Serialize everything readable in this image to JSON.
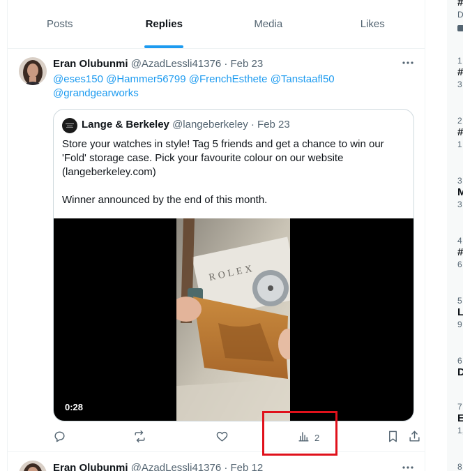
{
  "tabs": [
    {
      "label": "Posts",
      "active": false
    },
    {
      "label": "Replies",
      "active": true
    },
    {
      "label": "Media",
      "active": false
    },
    {
      "label": "Likes",
      "active": false
    }
  ],
  "post": {
    "author_name": "Eran Olubunmi",
    "handle": "@AzadLessli41376",
    "separator": "·",
    "date": "Feb 23",
    "mentions": [
      "@eses150",
      "@Hammer56799",
      "@FrenchEsthete",
      "@Tanstaafl50",
      "@grandgearworks"
    ],
    "quoted": {
      "author_name": "Lange & Berkeley",
      "handle": "@langeberkeley",
      "separator": "·",
      "date": "Feb 23",
      "text": "Store your watches in style! Tag 5 friends and get a chance to win our 'Fold' storage case. Pick your favourite colour on our website (langeberkeley.com)\n\nWinner announced by the end of this month.",
      "video_duration": "0:28",
      "video_watermark": "ROLEX"
    },
    "actions": {
      "reply_icon": "reply-icon",
      "repost_icon": "repost-icon",
      "like_icon": "like-icon",
      "views_icon": "views-icon",
      "views_count": "2",
      "bookmark_icon": "bookmark-icon",
      "share_icon": "share-icon"
    }
  },
  "next_post": {
    "author_name": "Eran Olubunmi",
    "handle": "@AzadLessli41376",
    "separator": "·",
    "date": "Feb 12"
  },
  "sidebar": {
    "top_line_1": "#",
    "top_line_2": "D",
    "trends": [
      {
        "num": "1",
        "title": "#",
        "count": "3"
      },
      {
        "num": "2",
        "title": "#",
        "count": "1"
      },
      {
        "num": "3",
        "title": "M",
        "count": "3"
      },
      {
        "num": "4",
        "title": "#",
        "count": "6"
      },
      {
        "num": "5",
        "title": "L",
        "count": "9"
      },
      {
        "num": "6",
        "title": "D",
        "count": ""
      },
      {
        "num": "7",
        "title": "E",
        "count": "1,"
      },
      {
        "num": "8",
        "title": "",
        "count": ""
      }
    ]
  },
  "colors": {
    "accent": "#1d9bf0",
    "highlight_box": "#e0111b",
    "muted_text": "#536471"
  }
}
